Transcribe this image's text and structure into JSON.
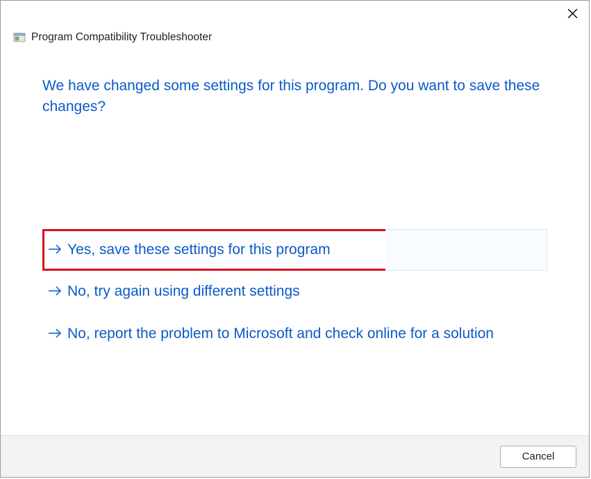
{
  "header": {
    "title": "Program Compatibility Troubleshooter"
  },
  "instruction": "We have changed some settings for this program. Do you want to save these changes?",
  "options": [
    {
      "label": "Yes, save these settings for this program",
      "highlighted": true
    },
    {
      "label": "No, try again using different settings",
      "highlighted": false
    },
    {
      "label": "No, report the problem to Microsoft and check online for a solution",
      "highlighted": false
    }
  ],
  "footer": {
    "cancel_label": "Cancel"
  }
}
